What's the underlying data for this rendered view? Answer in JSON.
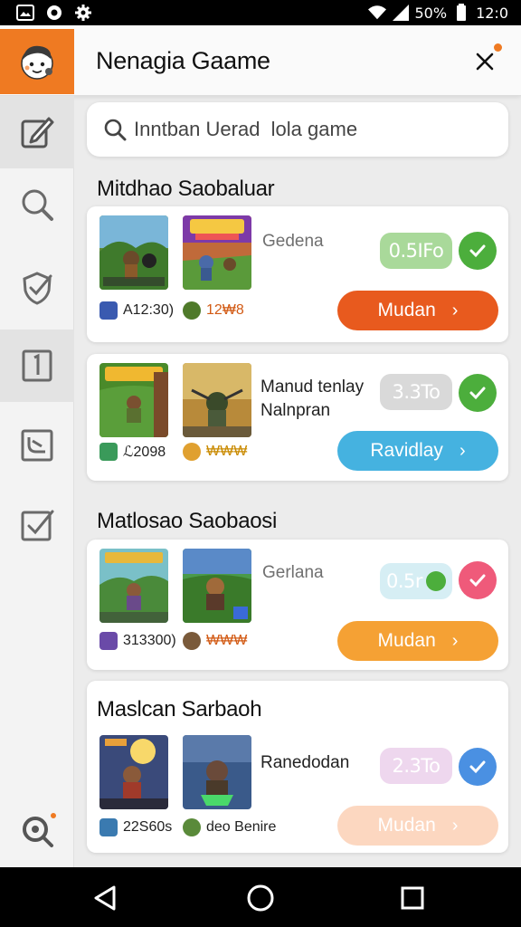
{
  "status_bar": {
    "battery": "50%",
    "time": "12:0",
    "icons": [
      "image-icon",
      "chat-bubble-icon",
      "settings-icon",
      "wifi-icon",
      "signal-icon",
      "battery-icon"
    ]
  },
  "header": {
    "title": "Nenagia Gaame",
    "logo_icon": "mascot-face-icon",
    "close_icon": "close-icon",
    "accent": "#ef7a22"
  },
  "sidebar": {
    "items": [
      {
        "icon": "edit-icon"
      },
      {
        "icon": "search-icon"
      },
      {
        "icon": "shield-check-icon"
      },
      {
        "icon": "number-one-icon"
      },
      {
        "icon": "list-edit-icon"
      },
      {
        "icon": "checkbox-icon"
      }
    ],
    "bottom_icon": "search-alert-icon"
  },
  "search": {
    "placeholder": "Inntban Uerad  lola game"
  },
  "sections": [
    {
      "title": "Mitdhao Saobaluar",
      "games": [
        {
          "stats": [
            "A12:30)",
            "12₩8"
          ],
          "label": "Gedena",
          "price": "0.5IFo",
          "button": "Mudan",
          "colors": {
            "pill_bg": "#a9d99a",
            "pill_fg": "#ffffff",
            "check": "#4cae3c",
            "button": "#e85a1e"
          }
        },
        {
          "stats": [
            "ℒ2098",
            "₩₩₩"
          ],
          "label": "Manud tenlay Nalnpran",
          "price": "3.3To",
          "button": "Ravidlay",
          "colors": {
            "pill_bg": "#d9d9d9",
            "pill_fg": "#ffffff",
            "check": "#4cae3c",
            "button": "#45b2e0"
          }
        }
      ]
    },
    {
      "title": "Matlosao Saobaosi",
      "games": [
        {
          "stats": [
            "313300)",
            "₩₩₩"
          ],
          "label": "Gerlana",
          "price": "0.5r",
          "button": "Mudan",
          "colors": {
            "pill_bg": "#d6eef4",
            "pill_fg": "#ffffff",
            "check": "#ef5a7a",
            "button": "#f5a134"
          }
        }
      ]
    },
    {
      "title": "Maslcan Sarbaoh",
      "games": [
        {
          "stats": [
            "22S60s",
            "deo Benire"
          ],
          "label": "Ranedodan",
          "price": "2.3To",
          "button": "Mudan",
          "colors": {
            "pill_bg": "#eed7ee",
            "pill_fg": "#ffffff",
            "check": "#4a90e2",
            "button": "#fcd7c0"
          }
        }
      ]
    }
  ],
  "nav": {
    "back_icon": "back-triangle-icon",
    "home_icon": "home-circle-icon",
    "recents_icon": "recents-square-icon"
  }
}
